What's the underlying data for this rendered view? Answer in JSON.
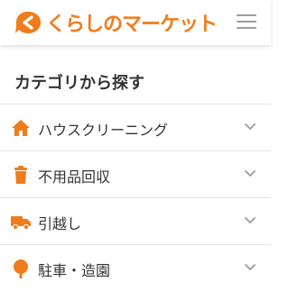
{
  "header": {
    "logo_text": "くらしのマーケット",
    "brand_color": "#F07C1B",
    "menu_icon": "hamburger-menu-icon"
  },
  "main": {
    "section_title": "カテゴリから探す",
    "categories": [
      {
        "label": "ハウスクリーニング",
        "icon": "house-icon"
      },
      {
        "label": "不用品回収",
        "icon": "trash-icon"
      },
      {
        "label": "引越し",
        "icon": "truck-icon"
      },
      {
        "label": "駐車・造園",
        "icon": "tree-icon"
      }
    ]
  }
}
